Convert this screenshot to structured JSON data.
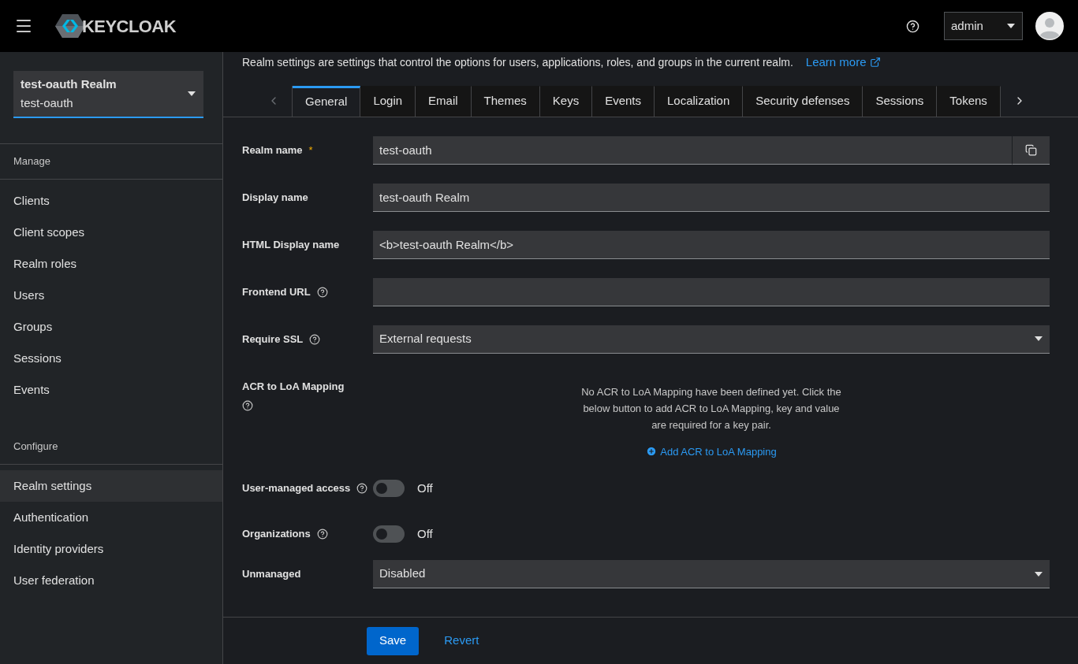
{
  "header": {
    "logo": "KEYCLOAK",
    "user": "admin"
  },
  "realm_selector": {
    "name": "test-oauth Realm",
    "id": "test-oauth"
  },
  "sidebar": {
    "sections": [
      {
        "title": "Manage",
        "items": [
          {
            "label": "Clients",
            "selected": false
          },
          {
            "label": "Client scopes",
            "selected": false
          },
          {
            "label": "Realm roles",
            "selected": false
          },
          {
            "label": "Users",
            "selected": false
          },
          {
            "label": "Groups",
            "selected": false
          },
          {
            "label": "Sessions",
            "selected": false
          },
          {
            "label": "Events",
            "selected": false
          }
        ]
      },
      {
        "title": "Configure",
        "items": [
          {
            "label": "Realm settings",
            "selected": true
          },
          {
            "label": "Authentication",
            "selected": false
          },
          {
            "label": "Identity providers",
            "selected": false
          },
          {
            "label": "User federation",
            "selected": false
          }
        ]
      }
    ]
  },
  "description": "Realm settings are settings that control the options for users, applications, roles, and groups in the current realm.",
  "learn_more": "Learn more",
  "tabs": [
    {
      "label": "General",
      "selected": true
    },
    {
      "label": "Login",
      "selected": false
    },
    {
      "label": "Email",
      "selected": false
    },
    {
      "label": "Themes",
      "selected": false
    },
    {
      "label": "Keys",
      "selected": false
    },
    {
      "label": "Events",
      "selected": false
    },
    {
      "label": "Localization",
      "selected": false
    },
    {
      "label": "Security defenses",
      "selected": false
    },
    {
      "label": "Sessions",
      "selected": false
    },
    {
      "label": "Tokens",
      "selected": false
    }
  ],
  "fields": [
    {
      "kind": "text",
      "label": "Realm name",
      "required_mark": "*",
      "help": false,
      "value": "test-oauth",
      "copy": true
    },
    {
      "kind": "text",
      "label": "Display name",
      "help": false,
      "value": "test-oauth Realm",
      "copy": false
    },
    {
      "kind": "text",
      "label": "HTML Display name",
      "help": false,
      "value": "<b>test-oauth Realm</b>",
      "copy": false
    },
    {
      "kind": "text",
      "label": "Frontend URL",
      "help": true,
      "copy": false
    },
    {
      "kind": "select",
      "label": "Require SSL",
      "help": true,
      "value": "External requests"
    },
    {
      "kind": "mapping",
      "label": "ACR to LoA Mapping",
      "help": true,
      "empty_text": "No ACR to LoA Mapping have been defined yet. Click the below button to add ACR to LoA Mapping, key and value are required for a key pair.",
      "add_label": "Add ACR to LoA Mapping"
    },
    {
      "kind": "switch",
      "label": "User-managed access",
      "help": true,
      "on": false,
      "state_text": "Off"
    },
    {
      "kind": "switch",
      "label": "Organizations",
      "help": true,
      "on": false,
      "state_text": "Off"
    },
    {
      "kind": "select",
      "label": "Unmanaged",
      "help": false,
      "value": "Disabled"
    }
  ],
  "footer": {
    "save": "Save",
    "revert": "Revert"
  }
}
